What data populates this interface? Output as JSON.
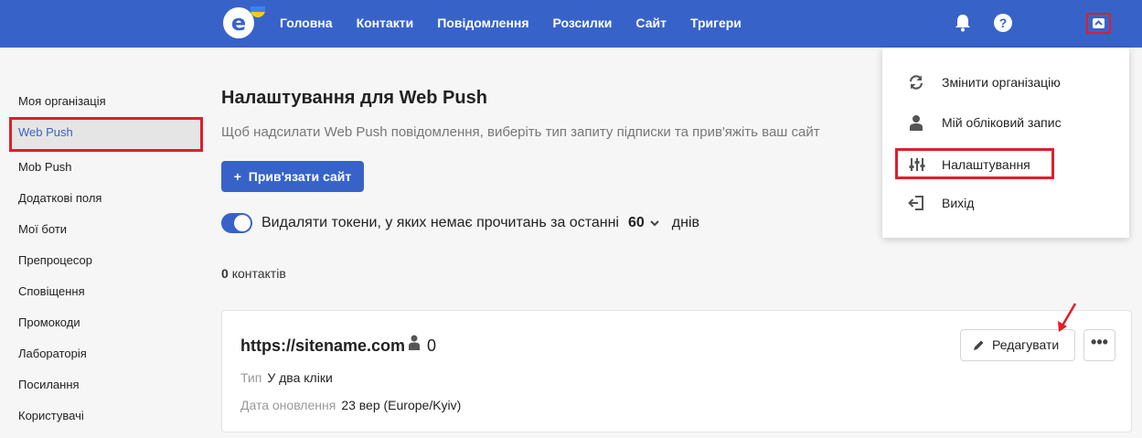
{
  "nav": {
    "items": [
      "Головна",
      "Контакти",
      "Повідомлення",
      "Розсилки",
      "Сайт",
      "Тригери"
    ]
  },
  "topbar_icons": [
    "bell-icon",
    "help-icon",
    "chevron-up-icon"
  ],
  "sidebar": {
    "items": [
      {
        "label": "Моя організація"
      },
      {
        "label": "Web Push"
      },
      {
        "label": "Mob Push"
      },
      {
        "label": "Додаткові поля"
      },
      {
        "label": "Мої боти"
      },
      {
        "label": "Препроцесор"
      },
      {
        "label": "Сповіщення"
      },
      {
        "label": "Промокоди"
      },
      {
        "label": "Лабораторія"
      },
      {
        "label": "Посилання"
      },
      {
        "label": "Користувачі"
      }
    ]
  },
  "main": {
    "title": "Налаштування для Web Push",
    "subtitle": "Щоб надсилати Web Push повідомлення, виберіть тип запиту підписки та прив'яжіть ваш сайт",
    "bind_button": "Прив'язати сайт",
    "bind_button_plus": "+",
    "toggle_text": "Видаляти токени, у яких немає прочитань за останні",
    "days_value": "60",
    "days_unit": "днів",
    "contacts_count": "0",
    "contacts_label": "контактів"
  },
  "card": {
    "url": "https://sitename.com",
    "subscribers": "0",
    "type_label": "Тип",
    "type_value": "У два кліки",
    "updated_label": "Дата оновлення",
    "updated_value": "23 вер (Europe/Kyiv)",
    "edit_button": "Редагувати",
    "more_button": "•••"
  },
  "dropdown": {
    "items": [
      {
        "label": "Змінити організацію",
        "icon": "sync-icon"
      },
      {
        "label": "Мій обліковий запис",
        "icon": "user-icon"
      },
      {
        "label": "Налаштування",
        "icon": "sliders-icon"
      },
      {
        "label": "Вихід",
        "icon": "logout-icon"
      }
    ]
  },
  "colors": {
    "brand": "#3763c9",
    "highlight": "#e11d2a",
    "background": "#f6f6f6"
  }
}
